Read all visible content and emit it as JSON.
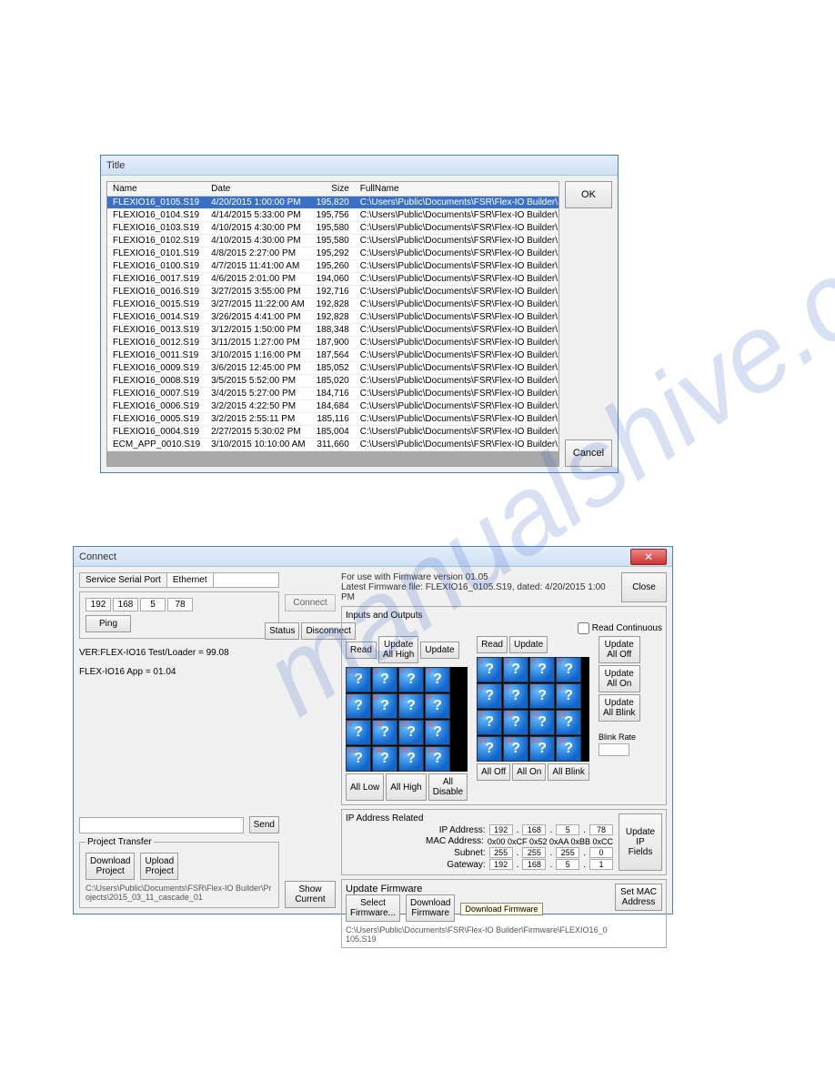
{
  "watermark": "manualshive.com",
  "dialog1": {
    "title": "Title",
    "headers": {
      "name": "Name",
      "date": "Date",
      "size": "Size",
      "fullname": "FullName"
    },
    "rows": [
      {
        "name": "FLEXIO16_0105.S19",
        "date": "4/20/2015 1:00:00 PM",
        "size": "195,820",
        "full": "C:\\Users\\Public\\Documents\\FSR\\Flex-IO Builder\\...",
        "sel": true
      },
      {
        "name": "FLEXIO16_0104.S19",
        "date": "4/14/2015 5:33:00 PM",
        "size": "195,756",
        "full": "C:\\Users\\Public\\Documents\\FSR\\Flex-IO Builder\\..."
      },
      {
        "name": "FLEXIO16_0103.S19",
        "date": "4/10/2015 4:30:00 PM",
        "size": "195,580",
        "full": "C:\\Users\\Public\\Documents\\FSR\\Flex-IO Builder\\..."
      },
      {
        "name": "FLEXIO16_0102.S19",
        "date": "4/10/2015 4:30:00 PM",
        "size": "195,580",
        "full": "C:\\Users\\Public\\Documents\\FSR\\Flex-IO Builder\\..."
      },
      {
        "name": "FLEXIO16_0101.S19",
        "date": "4/8/2015 2:27:00 PM",
        "size": "195,292",
        "full": "C:\\Users\\Public\\Documents\\FSR\\Flex-IO Builder\\..."
      },
      {
        "name": "FLEXIO16_0100.S19",
        "date": "4/7/2015 11:41:00 AM",
        "size": "195,260",
        "full": "C:\\Users\\Public\\Documents\\FSR\\Flex-IO Builder\\..."
      },
      {
        "name": "FLEXIO16_0017.S19",
        "date": "4/6/2015 2:01:00 PM",
        "size": "194,060",
        "full": "C:\\Users\\Public\\Documents\\FSR\\Flex-IO Builder\\..."
      },
      {
        "name": "FLEXIO16_0016.S19",
        "date": "3/27/2015 3:55:00 PM",
        "size": "192,716",
        "full": "C:\\Users\\Public\\Documents\\FSR\\Flex-IO Builder\\..."
      },
      {
        "name": "FLEXIO16_0015.S19",
        "date": "3/27/2015 11:22:00 AM",
        "size": "192,828",
        "full": "C:\\Users\\Public\\Documents\\FSR\\Flex-IO Builder\\..."
      },
      {
        "name": "FLEXIO16_0014.S19",
        "date": "3/26/2015 4:41:00 PM",
        "size": "192,828",
        "full": "C:\\Users\\Public\\Documents\\FSR\\Flex-IO Builder\\..."
      },
      {
        "name": "FLEXIO16_0013.S19",
        "date": "3/12/2015 1:50:00 PM",
        "size": "188,348",
        "full": "C:\\Users\\Public\\Documents\\FSR\\Flex-IO Builder\\..."
      },
      {
        "name": "FLEXIO16_0012.S19",
        "date": "3/11/2015 1:27:00 PM",
        "size": "187,900",
        "full": "C:\\Users\\Public\\Documents\\FSR\\Flex-IO Builder\\..."
      },
      {
        "name": "FLEXIO16_0011.S19",
        "date": "3/10/2015 1:16:00 PM",
        "size": "187,564",
        "full": "C:\\Users\\Public\\Documents\\FSR\\Flex-IO Builder\\..."
      },
      {
        "name": "FLEXIO16_0009.S19",
        "date": "3/6/2015 12:45:00 PM",
        "size": "185,052",
        "full": "C:\\Users\\Public\\Documents\\FSR\\Flex-IO Builder\\..."
      },
      {
        "name": "FLEXIO16_0008.S19",
        "date": "3/5/2015 5:52:00 PM",
        "size": "185,020",
        "full": "C:\\Users\\Public\\Documents\\FSR\\Flex-IO Builder\\..."
      },
      {
        "name": "FLEXIO16_0007.S19",
        "date": "3/4/2015 5:27:00 PM",
        "size": "184,716",
        "full": "C:\\Users\\Public\\Documents\\FSR\\Flex-IO Builder\\..."
      },
      {
        "name": "FLEXIO16_0006.S19",
        "date": "3/2/2015 4:22:50 PM",
        "size": "184,684",
        "full": "C:\\Users\\Public\\Documents\\FSR\\Flex-IO Builder\\..."
      },
      {
        "name": "FLEXIO16_0005.S19",
        "date": "3/2/2015 2:55:11 PM",
        "size": "185,116",
        "full": "C:\\Users\\Public\\Documents\\FSR\\Flex-IO Builder\\..."
      },
      {
        "name": "FLEXIO16_0004.S19",
        "date": "2/27/2015 5:30:02 PM",
        "size": "185,004",
        "full": "C:\\Users\\Public\\Documents\\FSR\\Flex-IO Builder\\..."
      },
      {
        "name": "ECM_APP_0010.S19",
        "date": "3/10/2015 10:10:00 AM",
        "size": "311,660",
        "full": "C:\\Users\\Public\\Documents\\FSR\\Flex-IO Builder\\..."
      }
    ],
    "ok": "OK",
    "cancel": "Cancel"
  },
  "dialog2": {
    "title": "Connect",
    "close": "Close",
    "tabs": {
      "serial": "Service Serial Port",
      "ethernet": "Ethernet"
    },
    "ip": [
      "192",
      "168",
      "5",
      "78"
    ],
    "ping": "Ping",
    "connect": "Connect",
    "status": "Status",
    "disconnect": "Disconnect",
    "ver1": "VER:FLEX-IO16 Test/Loader = 99.08",
    "ver2": "FLEX-IO16 App      = 01.04",
    "send": "Send",
    "pt": {
      "legend": "Project Transfer",
      "download": "Download\nProject",
      "upload": "Upload\nProject",
      "path": "C:\\Users\\Public\\Documents\\FSR\\Flex-IO Builder\\Projects\\2015_03_11_cascade_01"
    },
    "showcurrent": "Show\nCurrent",
    "fw": {
      "line1": "For use with Firmware version 01.05",
      "line2": "Latest Firmware file: FLEXIO16_0105.S19, dated: 4/20/2015 1:00 PM"
    },
    "io": {
      "legend": "Inputs and Outputs",
      "read": "Read",
      "updateallhigh": "Update\nAll High",
      "update": "Update",
      "readcont": "Read Continuous",
      "alllow": "All Low",
      "allhigh": "All High",
      "alldisable": "All\nDisable",
      "alloff": "All Off",
      "allon": "All On",
      "allblink": "All Blink",
      "updatealloff": "Update\nAll Off",
      "updateallon": "Update\nAll On",
      "updateallblink": "Update\nAll Blink",
      "blinkrate": "Blink Rate"
    },
    "ipsec": {
      "legend": "IP Address Related",
      "ipaddress": "IP Address:",
      "ip": [
        "192",
        "168",
        "5",
        "78"
      ],
      "macaddress": "MAC Address:",
      "mac": "0x00 0xCF 0x52 0xAA 0xBB 0xCC",
      "subnet": "Subnet:",
      "sub": [
        "255",
        "255",
        "255",
        "0"
      ],
      "gateway": "Gateway:",
      "gw": [
        "192",
        "168",
        "5",
        "1"
      ],
      "updateip": "Update\nIP\nFields"
    },
    "upfw": {
      "legend": "Update Firmware",
      "select": "Select\nFirmware...",
      "download": "Download\nFirmware",
      "tooltip": "Download Firmware",
      "path": "C:\\Users\\Public\\Documents\\FSR\\Flex-IO Builder\\Firmware\\FLEXIO16_0105.S19",
      "setmac": "Set MAC\nAddress"
    }
  }
}
